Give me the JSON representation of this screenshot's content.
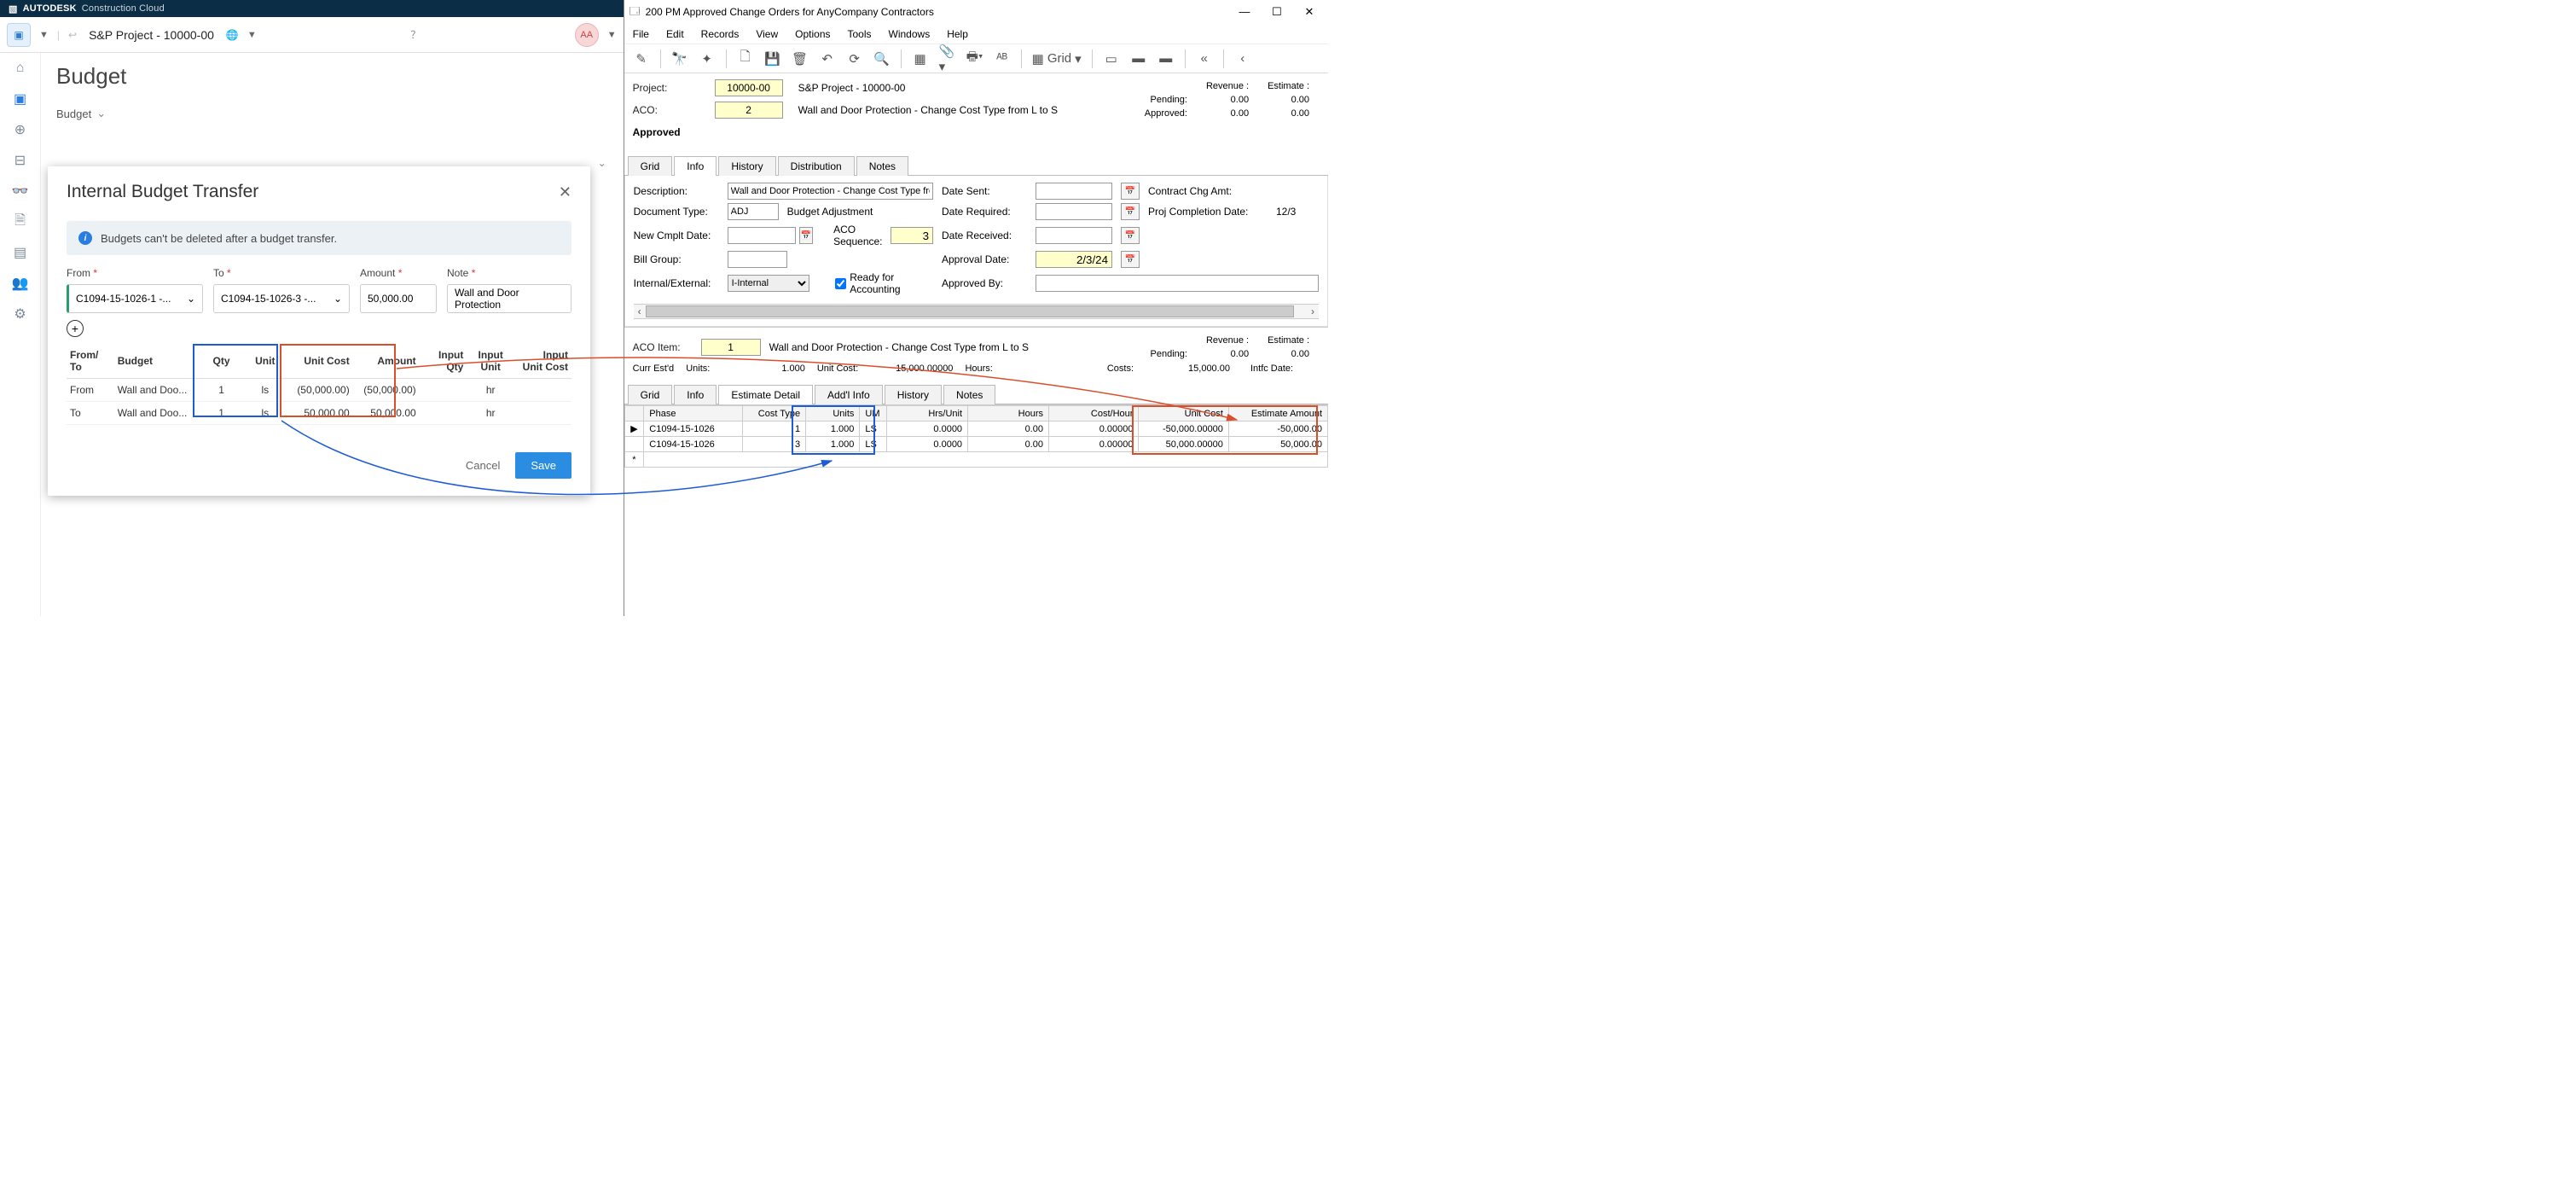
{
  "acc": {
    "brand_prefix": "AUTODESK",
    "brand_suffix": "Construction Cloud",
    "project": "S&P Project - 10000-00",
    "avatar": "AA",
    "page_title": "Budget",
    "breadcrumb": "Budget",
    "modal": {
      "title": "Internal Budget Transfer",
      "banner": "Budgets can't be deleted after a budget transfer.",
      "labels": {
        "from": "From",
        "to": "To",
        "amount": "Amount",
        "note": "Note",
        "star": "*"
      },
      "from_value": "C1094-15-1026-1 -...",
      "to_value": "C1094-15-1026-3 -...",
      "amount_value": "50,000.00",
      "note_value": "Wall and Door Protection",
      "table": {
        "headers": {
          "fromto": "From/\nTo",
          "budget": "Budget",
          "qty": "Qty",
          "unit": "Unit",
          "unitcost": "Unit Cost",
          "amount": "Amount",
          "iqty": "Input\nQty",
          "iunit": "Input\nUnit",
          "iuc": "Input\nUnit Cost"
        },
        "rows": [
          {
            "ft": "From",
            "budget": "Wall and Doo...",
            "qty": "1",
            "unit": "ls",
            "uc": "(50,000.00)",
            "amt": "(50,000.00)",
            "iq": "",
            "iu": "hr",
            "iuc": ""
          },
          {
            "ft": "To",
            "budget": "Wall and Doo...",
            "qty": "1",
            "unit": "ls",
            "uc": "50,000.00",
            "amt": "50,000.00",
            "iq": "",
            "iu": "hr",
            "iuc": ""
          }
        ]
      },
      "cancel": "Cancel",
      "save": "Save"
    }
  },
  "app": {
    "title": "200 PM Approved Change Orders for AnyCompany Contractors",
    "menu": [
      "File",
      "Edit",
      "Records",
      "View",
      "Options",
      "Tools",
      "Windows",
      "Help"
    ],
    "grid_btn": "Grid",
    "header": {
      "project_label": "Project:",
      "project_val": "10000-00",
      "project_desc": "S&P Project - 10000-00",
      "aco_label": "ACO:",
      "aco_val": "2",
      "aco_desc": "Wall and Door Protection - Change Cost Type from L to S",
      "status": "Approved",
      "summary": {
        "rev": "Revenue :",
        "est": "Estimate :",
        "pending": "Pending:",
        "approved": "Approved:",
        "z": "0.00"
      }
    },
    "tabs_top": [
      "Grid",
      "Info",
      "History",
      "Distribution",
      "Notes"
    ],
    "info": {
      "desc_l": "Description:",
      "desc_v": "Wall and Door Protection - Change Cost Type from L to S",
      "doctype_l": "Document Type:",
      "doctype_v": "ADJ",
      "doctype_desc": "Budget Adjustment",
      "ncd_l": "New Cmplt Date:",
      "seq_l": "ACO Sequence:",
      "seq_v": "3",
      "bill_l": "Bill Group:",
      "ie_l": "Internal/External:",
      "ie_v": "I-Internal",
      "ready": "Ready for Accounting",
      "ds_l": "Date Sent:",
      "dr_l": "Date Required:",
      "drc_l": "Date Received:",
      "ad_l": "Approval Date:",
      "ad_v": "2/3/24",
      "ab_l": "Approved By:",
      "cca_l": "Contract Chg Amt:",
      "pcd_l": "Proj Completion Date:",
      "pcd_v": "12/3"
    },
    "item": {
      "label": "ACO Item:",
      "val": "1",
      "desc": "Wall and Door Protection - Change Cost Type from L to S",
      "curr": "Curr Est'd",
      "units_l": "Units:",
      "units_v": "1.000",
      "uc_l": "Unit Cost:",
      "uc_v": "15,000.00000",
      "hrs_l": "Hours:",
      "costs_l": "Costs:",
      "costs_v": "15,000.00",
      "intfc": "Intfc Date:"
    },
    "tabs_bot": [
      "Grid",
      "Info",
      "Estimate Detail",
      "Add'l Info",
      "History",
      "Notes"
    ],
    "detail": {
      "headers": [
        "Phase",
        "Cost Type",
        "Units",
        "UM",
        "Hrs/Unit",
        "Hours",
        "Cost/Hour",
        "Unit Cost",
        "Estimate Amount"
      ],
      "rows": [
        {
          "phase": "C1094-15-1026",
          "ct": "1",
          "u": "1.000",
          "um": "LS",
          "hu": "0.0000",
          "h": "0.00",
          "ch": "0.00000",
          "uc": "-50,000.00000",
          "ea": "-50,000.00"
        },
        {
          "phase": "C1094-15-1026",
          "ct": "3",
          "u": "1.000",
          "um": "LS",
          "hu": "0.0000",
          "h": "0.00",
          "ch": "0.00000",
          "uc": "50,000.00000",
          "ea": "50,000.00"
        }
      ]
    }
  }
}
